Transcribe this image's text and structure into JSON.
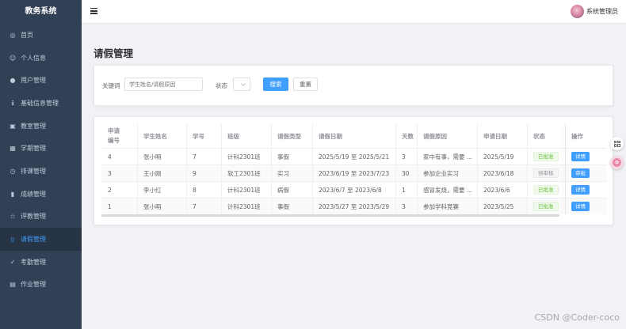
{
  "app": {
    "brand": "教务系统"
  },
  "sidebar": {
    "items": [
      {
        "label": "首页",
        "icon": "compass-icon",
        "glyph": "◎",
        "active": false
      },
      {
        "label": "个人信息",
        "icon": "user-outline-icon",
        "glyph": "☺",
        "active": false
      },
      {
        "label": "用户管理",
        "icon": "user-icon",
        "glyph": "●",
        "active": false
      },
      {
        "label": "基础信息管理",
        "icon": "info-icon",
        "glyph": "ℹ",
        "active": false
      },
      {
        "label": "教室管理",
        "icon": "classroom-icon",
        "glyph": "▣",
        "active": false
      },
      {
        "label": "学期管理",
        "icon": "calendar-icon",
        "glyph": "▦",
        "active": false
      },
      {
        "label": "排课管理",
        "icon": "timer-icon",
        "glyph": "◷",
        "active": false
      },
      {
        "label": "成绩管理",
        "icon": "bar-chart-icon",
        "glyph": "▮",
        "active": false
      },
      {
        "label": "评教管理",
        "icon": "star-icon",
        "glyph": "☆",
        "active": false
      },
      {
        "label": "请假管理",
        "icon": "document-icon",
        "glyph": "▯",
        "active": true
      },
      {
        "label": "考勤管理",
        "icon": "check-icon",
        "glyph": "✓",
        "active": false
      },
      {
        "label": "作业管理",
        "icon": "file-icon",
        "glyph": "▤",
        "active": false
      }
    ]
  },
  "header": {
    "username": "系统管理员"
  },
  "page": {
    "title": "请假管理"
  },
  "search": {
    "keyword_label": "关键词",
    "keyword_placeholder": "学生姓名/请假原因",
    "status_label": "状态",
    "search_button": "搜索",
    "reset_button": "重置"
  },
  "table": {
    "columns": [
      "申请编号",
      "学生姓名",
      "学号",
      "班级",
      "请假类型",
      "请假日期",
      "天数",
      "请假原因",
      "申请日期",
      "状态",
      "操作"
    ],
    "rows": [
      {
        "id": "4",
        "name": "张小明",
        "student_no": "7",
        "class": "计科2301班",
        "type": "事假",
        "dates": "2025/5/19 至 2025/5/21",
        "days": "3",
        "reason": "家中有事，需要 ...",
        "apply_date": "2025/5/19",
        "status": "已批准",
        "status_kind": "ok",
        "action": "详情"
      },
      {
        "id": "3",
        "name": "王小刚",
        "student_no": "9",
        "class": "软工2301班",
        "type": "实习",
        "dates": "2023/6/19 至 2023/7/23",
        "days": "30",
        "reason": "参加企业实习",
        "apply_date": "2023/6/18",
        "status": "待审核",
        "status_kind": "wait",
        "action": "审批"
      },
      {
        "id": "2",
        "name": "李小红",
        "student_no": "8",
        "class": "计科2301班",
        "type": "病假",
        "dates": "2023/6/7 至 2023/6/8",
        "days": "1",
        "reason": "感冒发烧，需要 ...",
        "apply_date": "2023/6/6",
        "status": "已批准",
        "status_kind": "ok",
        "action": "详情"
      },
      {
        "id": "1",
        "name": "张小明",
        "student_no": "7",
        "class": "计科2301班",
        "type": "事假",
        "dates": "2023/5/27 至 2023/5/29",
        "days": "3",
        "reason": "参加学科竞赛",
        "apply_date": "2023/5/25",
        "status": "已批准",
        "status_kind": "ok",
        "action": "详情"
      }
    ]
  },
  "watermark": "CSDN @Coder-coco",
  "colors": {
    "sidebar_bg": "#304156",
    "accent": "#409eff",
    "success": "#67c23a"
  }
}
